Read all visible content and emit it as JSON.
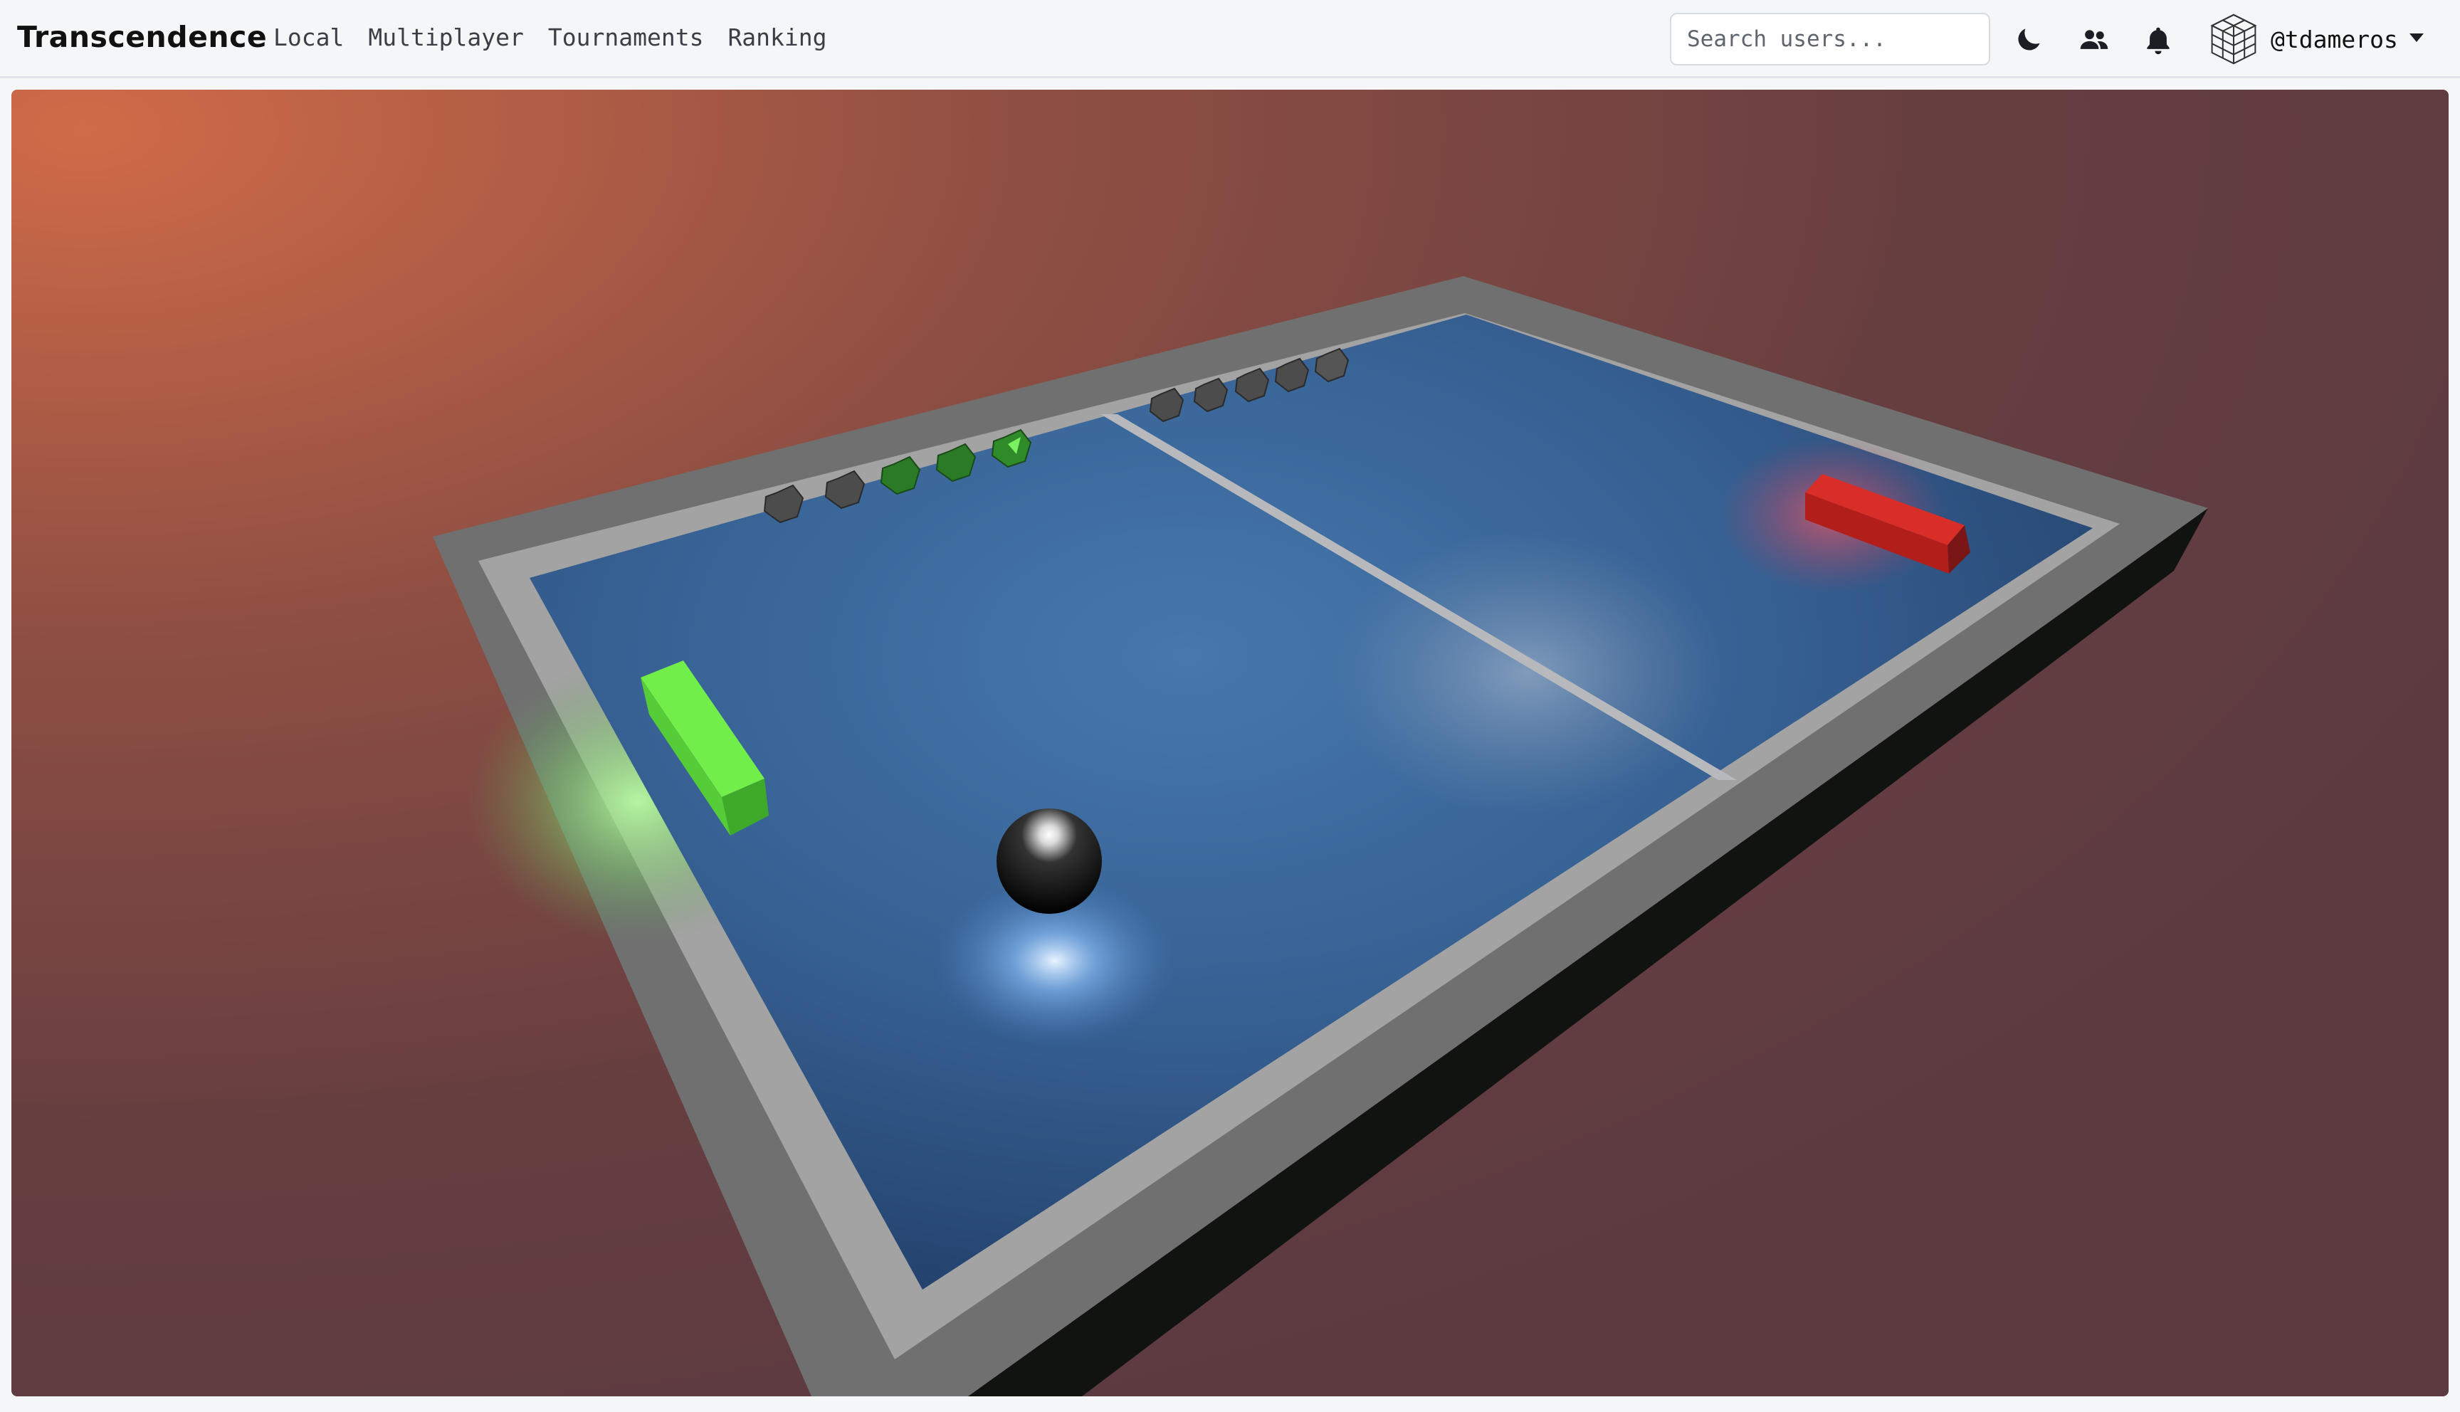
{
  "navbar": {
    "brand": "Transcendence",
    "links": [
      {
        "label": "Local"
      },
      {
        "label": "Multiplayer"
      },
      {
        "label": "Tournaments"
      },
      {
        "label": "Ranking"
      }
    ],
    "search_placeholder": "Search users...",
    "icons": [
      "moon-icon",
      "friends-icon",
      "bell-icon"
    ],
    "username": "@tdameros"
  },
  "game": {
    "player_paddle_color": "#6fee4a",
    "opponent_paddle_color": "#d7302b",
    "table_color": "#3a6496",
    "border_color": "#8a8a8a",
    "score_left": {
      "total": 5,
      "lit": 3,
      "lit_color": "#2f8a2a"
    },
    "score_right": {
      "total": 5,
      "lit": 0
    }
  }
}
